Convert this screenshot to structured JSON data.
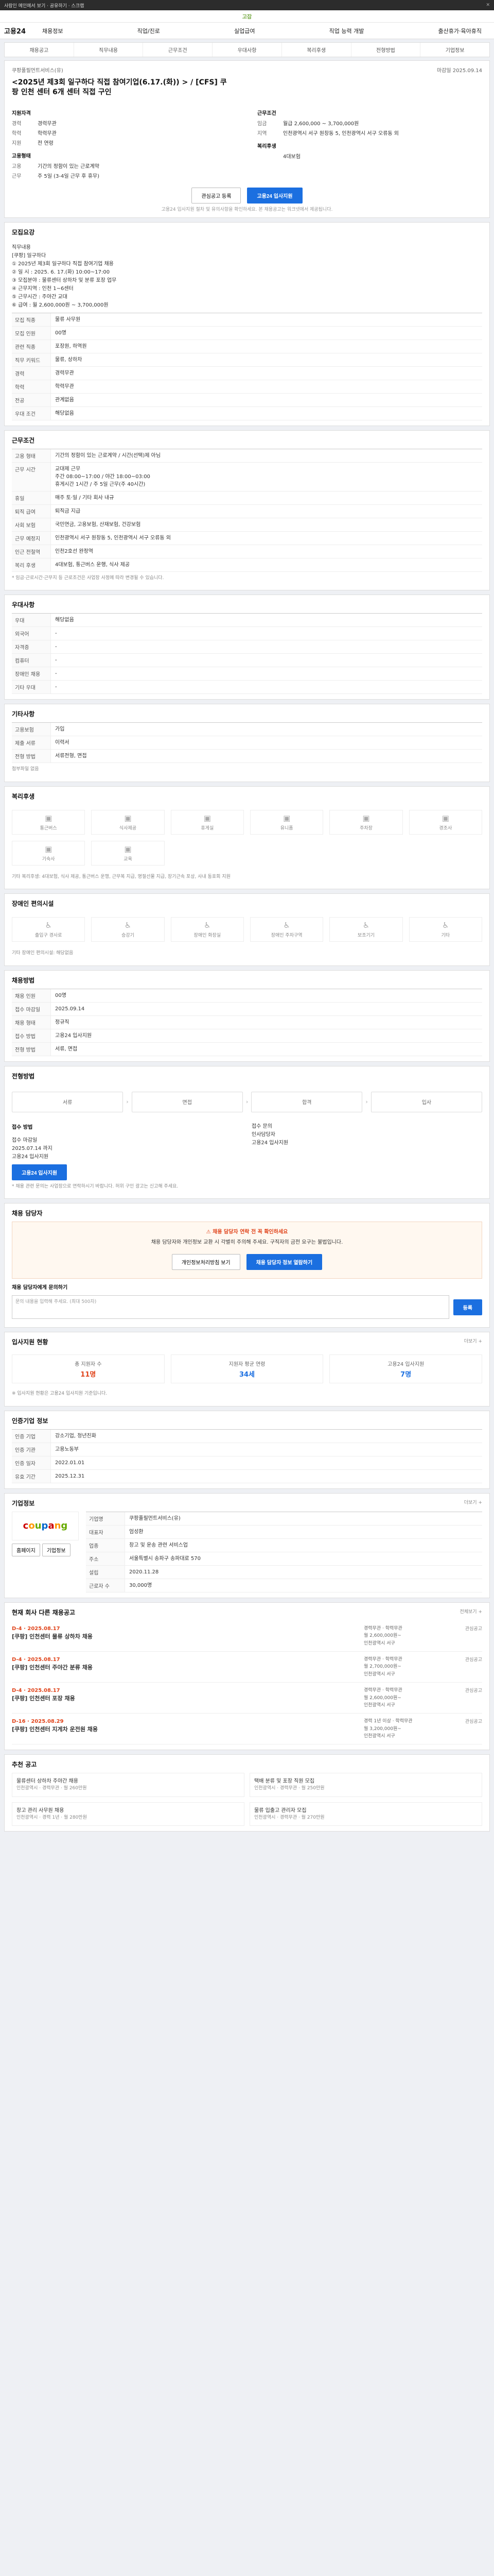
{
  "topbar": {
    "text": "사람인 메인에서 보기 · 공유하기 · 스크랩",
    "close": "✕"
  },
  "logo": "고잡",
  "nav": {
    "brand": "고용24",
    "menu": [
      "채용정보",
      "직업/진로",
      "실업급여",
      "직업 능력 개발",
      "출산휴가·육아휴직"
    ]
  },
  "tabs": [
    "채용공고",
    "직무내용",
    "근무조건",
    "우대사항",
    "복리후생",
    "전형방법",
    "기업정보"
  ],
  "job": {
    "company": "쿠팡풀필먼트서비스(유)",
    "date": "마감일 2025.09.14",
    "title": "<2025년 제3회 일구하다 직접 참여기업(6.17.(화)) > / [CFS] 쿠팡 인천 센터 6개 센터 직접 구인",
    "left_head": "지원자격",
    "left": [
      [
        "경력",
        "경력무관"
      ],
      [
        "학력",
        "학력무관"
      ],
      [
        "지원",
        "전 연령"
      ]
    ],
    "left_head2": "고용형태",
    "left2": [
      [
        "고용",
        "기간의 정함이 있는 근로계약"
      ],
      [
        "근무",
        "주 5일 (3-4일 근무 후 휴무)"
      ]
    ],
    "right_head": "근무조건",
    "right": [
      [
        "임금",
        "월급 2,600,000 ~ 3,700,000원"
      ],
      [
        "지역",
        "인천광역시 서구 원창동 5, 인천광역시 서구 오류동 외"
      ]
    ],
    "right_head2": "복리후생",
    "right2": [
      [
        "",
        "4대보험"
      ]
    ],
    "btn_scrap": "관심공고 등록",
    "btn_apply": "고용24 입사지원",
    "note": "고용24 입사지원 절차 및 유의사항을 확인하세요. 본 채용공고는 워크넷에서 제공됩니다."
  },
  "detail": {
    "title": "모집요강",
    "body": "직무내용\n[쿠팡] 일구하다\n① 2025년 제3회 일구하다 직접 참여기업 채용\n② 일 시 : 2025. 6. 17.(화) 10:00~17:00\n③ 모집분야 : 물류센터 상하차 및 분류 포장 업무\n④ 근무지역 : 인천 1~6센터\n⑤ 근무시간 : 주야간 교대\n⑥ 급여 : 월 2,600,000원 ~ 3,700,000원",
    "rows": [
      [
        "모집 직종",
        "물류 사무원"
      ],
      [
        "모집 인원",
        "00명"
      ],
      [
        "관련 직종",
        "포장원, 하역원"
      ],
      [
        "직무 키워드",
        "물류, 상하차"
      ],
      [
        "경력",
        "경력무관"
      ],
      [
        "학력",
        "학력무관"
      ],
      [
        "전공",
        "관계없음"
      ],
      [
        "우대 조건",
        "해당없음"
      ]
    ]
  },
  "cond": {
    "title": "근무조건",
    "rows": [
      [
        "고용 형태",
        "기간의 정함이 있는 근로계약 / 시간(선택)제 아님"
      ],
      [
        "근무 시간",
        "교대제 근무\n주간 08:00~17:00 / 야간 18:00~03:00\n휴게시간 1시간 / 주 5일 근무(주 40시간)"
      ],
      [
        "휴일",
        "매주 토·일 / 기타 회사 내규"
      ],
      [
        "퇴직 급여",
        "퇴직금 지급"
      ],
      [
        "사회 보험",
        "국민연금, 고용보험, 산재보험, 건강보험"
      ],
      [
        "근무 예정지",
        "인천광역시 서구 원창동 5, 인천광역시 서구 오류동 외"
      ],
      [
        "인근 전철역",
        "인천2호선 완정역"
      ],
      [
        "복리 후생",
        "4대보험, 통근버스 운행, 식사 제공"
      ]
    ],
    "note": "* 임금·근로시간·근무지 등 근로조건은 사업장 사정에 따라 변경될 수 있습니다."
  },
  "pref": {
    "title": "우대사항",
    "rows": [
      [
        "우대",
        "해당없음"
      ],
      [
        "외국어",
        "-"
      ],
      [
        "자격증",
        "-"
      ],
      [
        "컴퓨터",
        "-"
      ],
      [
        "장애인 채용",
        "-"
      ],
      [
        "기타 우대",
        "-"
      ]
    ]
  },
  "etc": {
    "title": "기타사항",
    "rows": [
      [
        "고용보험",
        "가입"
      ],
      [
        "제출 서류",
        "이력서"
      ],
      [
        "전형 방법",
        "서류전형, 면접"
      ]
    ],
    "link": "첨부파일 없음"
  },
  "welfare": {
    "title": "복리후생",
    "items": [
      "통근버스",
      "식사제공",
      "휴게실",
      "유니폼",
      "주차장",
      "경조사",
      "기숙사",
      "교육"
    ],
    "note": "기타 복리후생: 4대보험, 식사 제공, 통근버스 운행, 근무복 지급, 명절선물 지급, 장기근속 포상, 사내 동호회 지원"
  },
  "disab": {
    "title": "장애인 편의시설",
    "items": [
      "출입구 경사로",
      "승강기",
      "장애인 화장실",
      "장애인 주차구역",
      "보조기기",
      "기타"
    ],
    "note": "기타 장애인 편의시설: 해당없음"
  },
  "recruit": {
    "title": "채용방법",
    "rows": [
      [
        "채용 인원",
        "00명"
      ],
      [
        "접수 마감일",
        "2025.09.14"
      ],
      [
        "채용 형태",
        "정규직"
      ],
      [
        "접수 방법",
        "고용24 입사지원"
      ],
      [
        "전형 방법",
        "서류, 면접"
      ]
    ]
  },
  "process": {
    "title": "전형방법",
    "steps": [
      "서류",
      "면접",
      "합격",
      "입사"
    ]
  },
  "apply": {
    "title": "접수 방법",
    "text": "접수 마감일\n2025.07.14 까지\n고용24 입사지원",
    "contact": "접수 문의\n인사담당자\n고용24 입사지원",
    "btn": "고용24 입사지원",
    "note": "* 채용 관련 문의는 사업장으로 연락하시기 바랍니다. 허위 구인 광고는 신고해 주세요."
  },
  "caution": {
    "title": "채용 담당자",
    "warn_title": "⚠ 채용 담당자 연락 전 꼭 확인하세요",
    "warn_body": "채용 담당자와 개인정보 교환 시 각별히 주의해 주세요. 구직자의 금전 요구는 불법입니다.",
    "btn1": "개인정보처리방침 보기",
    "btn2": "채용 담당자 정보 열람하기"
  },
  "qa": {
    "title": "채용 담당자에게 문의하기",
    "placeholder": "문의 내용을 입력해 주세요. (최대 500자)",
    "btn": "등록"
  },
  "stats": {
    "title": "입사지원 현황",
    "more": "더보기 +",
    "items": [
      [
        "총 지원자 수",
        "11명"
      ],
      [
        "지원자 평균 연령",
        "34세"
      ],
      [
        "고용24 입사지원",
        "7명"
      ]
    ],
    "note": "※ 입사지원 현황은 고용24 입사지원 기준입니다."
  },
  "info": {
    "title": "인증기업 정보",
    "rows": [
      [
        "인증 기업",
        "강소기업, 청년친화"
      ],
      [
        "인증 기관",
        "고용노동부"
      ],
      [
        "인증 일자",
        "2022.01.01"
      ],
      [
        "유효 기간",
        "2025.12.31"
      ]
    ]
  },
  "company": {
    "title": "기업정보",
    "more": "더보기 +",
    "logo": [
      "c",
      "o",
      "u",
      "p",
      "a",
      "n",
      "g"
    ],
    "rows": [
      [
        "기업명",
        "쿠팡풀필먼트서비스(유)"
      ],
      [
        "대표자",
        "엄성환"
      ],
      [
        "업종",
        "창고 및 운송 관련 서비스업"
      ],
      [
        "주소",
        "서울특별시 송파구 송파대로 570"
      ],
      [
        "설립",
        "2020.11.28"
      ],
      [
        "근로자 수",
        "30,000명"
      ]
    ],
    "btn1": "홈페이지",
    "btn2": "기업정보"
  },
  "others": {
    "title": "현재 회사 다른 채용공고",
    "more": "전체보기 +",
    "items": [
      {
        "tag": "D-4 · 2025.08.17",
        "co": "[쿠팡] 인천센터 물류 상하차 채용",
        "m": "경력무관 · 학력무관\n월 2,600,000원~\n인천광역시 서구",
        "r": "관심공고"
      },
      {
        "tag": "D-4 · 2025.08.17",
        "co": "[쿠팡] 인천센터 주야간 분류 채용",
        "m": "경력무관 · 학력무관\n월 2,700,000원~\n인천광역시 서구",
        "r": "관심공고"
      },
      {
        "tag": "D-4 · 2025.08.17",
        "co": "[쿠팡] 인천센터 포장 채용",
        "m": "경력무관 · 학력무관\n월 2,600,000원~\n인천광역시 서구",
        "r": "관심공고"
      },
      {
        "tag": "D-16 · 2025.08.29",
        "co": "[쿠팡] 인천센터 지게차 운전원 채용",
        "m": "경력 1년 이상 · 학력무관\n월 3,200,000원~\n인천광역시 서구",
        "r": "관심공고"
      }
    ]
  },
  "recom": {
    "title": "추천 공고",
    "items": [
      {
        "t": "물류센터 상하차 주야간 채용",
        "s": "인천광역시 · 경력무관 · 월 260만원"
      },
      {
        "t": "택배 분류 및 포장 직원 모집",
        "s": "인천광역시 · 경력무관 · 월 250만원"
      },
      {
        "t": "창고 관리 사무원 채용",
        "s": "인천광역시 · 경력 1년 · 월 280만원"
      },
      {
        "t": "물류 입출고 관리자 모집",
        "s": "인천광역시 · 경력무관 · 월 270만원"
      }
    ]
  }
}
